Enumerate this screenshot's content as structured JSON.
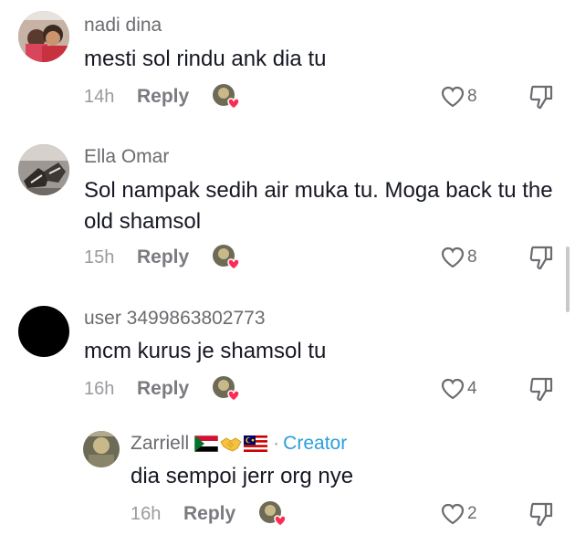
{
  "comments": [
    {
      "username": "nadi dina",
      "text": "mesti sol rindu ank dia tu",
      "time": "14h",
      "reply": "Reply",
      "likes": "8",
      "avatar": "photo-couple-avatar"
    },
    {
      "username": "Ella Omar",
      "text": "Sol nampak sedih air muka tu. Moga back tu the old shamsol",
      "time": "15h",
      "reply": "Reply",
      "likes": "8",
      "avatar": "photo-shoes-avatar"
    },
    {
      "username": "user 3499863802773",
      "text": "mcm kurus je shamsol tu",
      "time": "16h",
      "reply": "Reply",
      "likes": "4",
      "avatar": "black-avatar"
    }
  ],
  "reply_comment": {
    "username": "Zarriell",
    "flags": [
      "sudan-flag",
      "handshake-emoji",
      "malaysia-flag"
    ],
    "separator": "·",
    "creator_label": "Creator",
    "text": "dia sempoi jerr org nye",
    "time": "16h",
    "reply": "Reply",
    "likes": "2"
  },
  "colors": {
    "creator": "#2b9fd9",
    "heart_badge": "#fe2c55",
    "muted": "#9a9aa0"
  }
}
